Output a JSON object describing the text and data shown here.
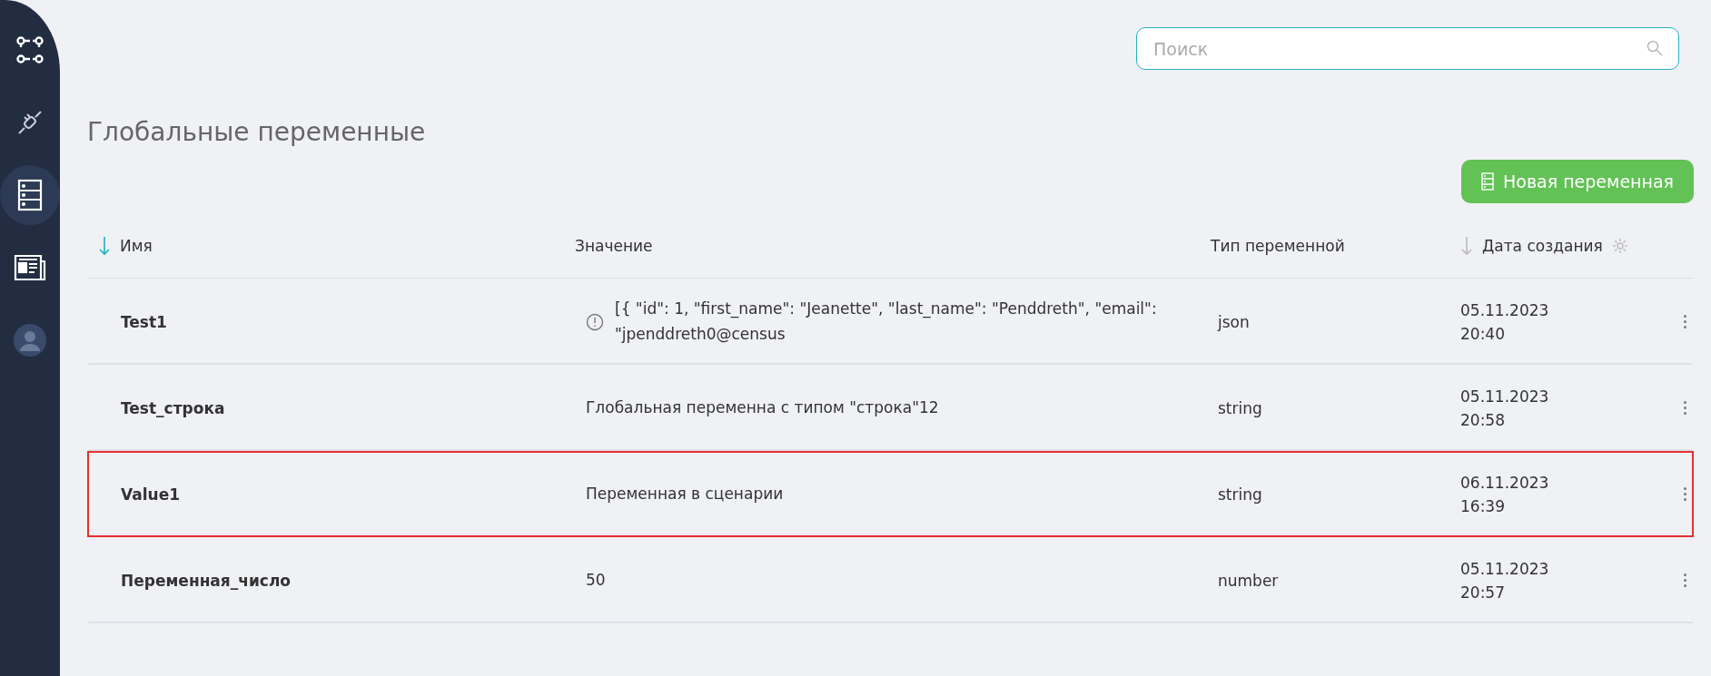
{
  "search": {
    "placeholder": "Поиск"
  },
  "page_title": "Глобальные переменные",
  "new_button": "Новая переменная",
  "sidebar": [
    {
      "kind": "graph",
      "selected": false
    },
    {
      "kind": "plug",
      "selected": false
    },
    {
      "kind": "server",
      "selected": true
    },
    {
      "kind": "news",
      "selected": false
    },
    {
      "kind": "user",
      "selected": false
    }
  ],
  "columns": [
    {
      "kind": "sorted",
      "label": "Имя",
      "settings": false
    },
    {
      "kind": "plain",
      "label": "Значение",
      "settings": false
    },
    {
      "kind": "plain",
      "label": "Тип переменной",
      "settings": false
    },
    {
      "kind": "sortable",
      "label": "Дата создания",
      "settings": true
    }
  ],
  "rows": [
    {
      "name": "Test1",
      "value": "[{ \"id\": 1, \"first_name\": \"Jeanette\", \"last_name\": \"Penddreth\", \"email\": \"jpenddreth0@census",
      "warning": true,
      "type": "json",
      "date": "05.11.2023",
      "time": "20:40",
      "selected": false
    },
    {
      "name": "Test_строка",
      "value": "Глобальная переменна с типом \"строка\"12",
      "warning": false,
      "type": "string",
      "date": "05.11.2023",
      "time": "20:58",
      "selected": false
    },
    {
      "name": "Value1",
      "value": "Переменная в сценарии",
      "warning": false,
      "type": "string",
      "date": "06.11.2023",
      "time": "16:39",
      "selected": true
    },
    {
      "name": "Переменная_число",
      "value": "50",
      "warning": false,
      "type": "number",
      "date": "05.11.2023",
      "time": "20:57",
      "selected": false
    }
  ]
}
